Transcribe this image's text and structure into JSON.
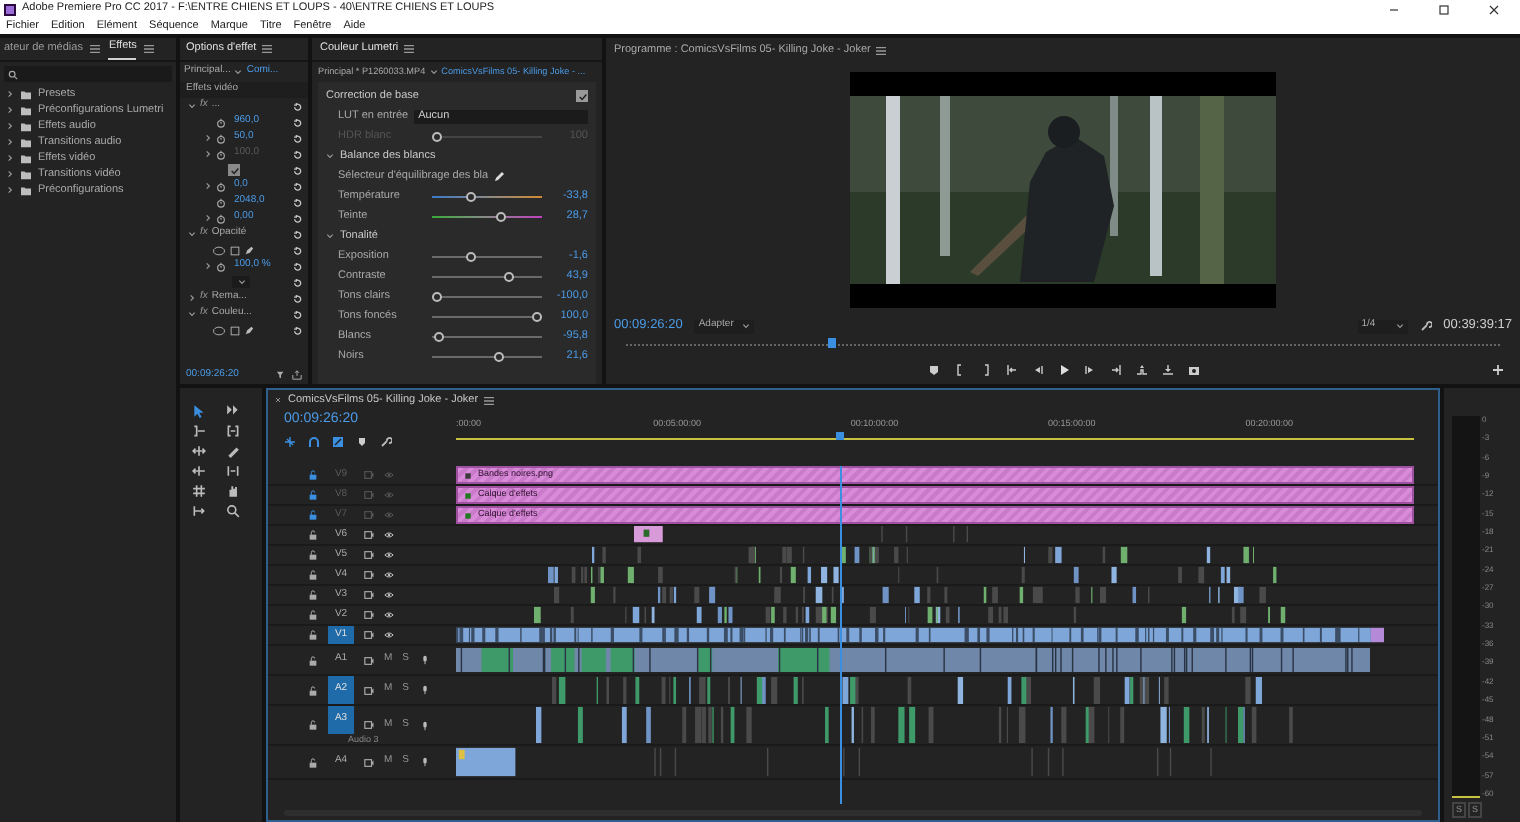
{
  "window": {
    "title": "Adobe Premiere Pro CC 2017 - F:\\ENTRE CHIENS ET LOUPS - 40\\ENTRE CHIENS ET LOUPS"
  },
  "menu": [
    "Fichier",
    "Edition",
    "Elément",
    "Séquence",
    "Marque",
    "Titre",
    "Fenêtre",
    "Aide"
  ],
  "effects_panel": {
    "tabs": [
      {
        "label": "ateur de médias",
        "selected": false
      },
      {
        "label": "Effets",
        "selected": true
      }
    ],
    "items": [
      {
        "label": "Presets"
      },
      {
        "label": "Préconfigurations Lumetri"
      },
      {
        "label": "Effets audio"
      },
      {
        "label": "Transitions audio"
      },
      {
        "label": "Effets vidéo"
      },
      {
        "label": "Transitions vidéo"
      },
      {
        "label": "Préconfigurations"
      }
    ]
  },
  "effect_options": {
    "tab": "Options d'effet",
    "source": "Principal...",
    "sequence": "Comi...",
    "section": "Effets vidéo",
    "timecode": "00:09:26:20",
    "rows": [
      {
        "kind": "effect",
        "badge": "fx",
        "label": "...",
        "expanded": true
      },
      {
        "kind": "param",
        "value": "960,0",
        "expandable": false,
        "disabled": false
      },
      {
        "kind": "param",
        "value": "50,0",
        "expandable": true,
        "disabled": false
      },
      {
        "kind": "param",
        "value": "100,0",
        "expandable": true,
        "disabled": true
      },
      {
        "kind": "checkbox",
        "checked": true
      },
      {
        "kind": "param",
        "value": "0,0",
        "expandable": true,
        "disabled": false
      },
      {
        "kind": "param",
        "value": "2048,0",
        "expandable": false,
        "disabled": false
      },
      {
        "kind": "param",
        "value": "0,00",
        "expandable": true,
        "disabled": false
      },
      {
        "kind": "effect",
        "badge": "fx",
        "label": "Opacité",
        "expanded": true
      },
      {
        "kind": "masks"
      },
      {
        "kind": "param",
        "value": "100,0 %",
        "expandable": true,
        "disabled": false
      },
      {
        "kind": "dropdown"
      },
      {
        "kind": "effect",
        "badge": "fx",
        "label": "Rema...",
        "expanded": false
      },
      {
        "kind": "effect",
        "badge": "fx",
        "label": "Couleu...",
        "expanded": true
      },
      {
        "kind": "masks"
      }
    ]
  },
  "lumetri": {
    "tab": "Couleur Lumetri",
    "source": "Principal * P1260033.MP4",
    "sequence": "ComicsVsFilms 05- Killing Joke - ...",
    "rows": [
      {
        "kind": "section",
        "label": "Correction de base",
        "checked": true
      },
      {
        "kind": "dropdown",
        "label": "LUT en entrée",
        "value": "Aucun"
      },
      {
        "kind": "slider",
        "label": "HDR blanc",
        "level": 0,
        "reading": "100",
        "disabled": true
      },
      {
        "kind": "group",
        "label": "Balance des blancs",
        "expanded": true
      },
      {
        "kind": "picker",
        "label": "Sélecteur d'équilibrage des bla"
      },
      {
        "kind": "temperature-slider",
        "label": "Température",
        "level": 0.33,
        "reading": "-33,8",
        "disabled": false
      },
      {
        "kind": "tint-slider",
        "label": "Teinte",
        "level": 0.64,
        "reading": "28,7",
        "disabled": false
      },
      {
        "kind": "group",
        "label": "Tonalité",
        "expanded": true
      },
      {
        "kind": "slider",
        "label": "Exposition",
        "level": 0.34,
        "reading": "-1,6",
        "disabled": false
      },
      {
        "kind": "slider",
        "label": "Contraste",
        "level": 0.72,
        "reading": "43,9",
        "disabled": false
      },
      {
        "kind": "slider",
        "label": "Tons clairs",
        "level": 0,
        "reading": "-100,0",
        "disabled": false
      },
      {
        "kind": "slider",
        "label": "Tons foncés",
        "level": 1,
        "reading": "100,0",
        "disabled": false
      },
      {
        "kind": "slider",
        "label": "Blancs",
        "level": 0.02,
        "reading": "-95,8",
        "disabled": false
      },
      {
        "kind": "slider",
        "label": "Noirs",
        "level": 0.61,
        "reading": "21,6",
        "disabled": false
      }
    ]
  },
  "program": {
    "title": "Programme : ComicsVsFilms 05- Killing Joke - Joker",
    "timecode": "00:09:26:20",
    "fit": "Adapter",
    "resolution": "1/4",
    "duration": "00:39:39:17",
    "playhead": {
      "level": 0.23
    }
  },
  "timeline": {
    "title": "ComicsVsFilms 05- Killing Joke - Joker",
    "timecode": "00:09:26:20",
    "ruler": [
      ":00:00",
      "00:05:00:00",
      "00:10:00:00",
      "00:15:00:00",
      "00:20:00:00"
    ],
    "playhead": {
      "level": 0.4
    },
    "tools": [
      {
        "selected": true
      },
      {
        "selected": false
      },
      {
        "selected": false
      },
      {
        "selected": false
      },
      {
        "selected": false
      },
      {
        "selected": false
      },
      {
        "selected": false
      },
      {
        "selected": false
      },
      {
        "selected": false
      },
      {
        "selected": false
      },
      {
        "selected": false
      },
      {
        "selected": false
      }
    ],
    "tracks": [
      {
        "kind": "video",
        "name": "V9",
        "locked": true,
        "targeted": false,
        "clip": "Bandes noires.png"
      },
      {
        "kind": "video",
        "name": "V8",
        "locked": true,
        "targeted": false,
        "clip": "Calque d'effets"
      },
      {
        "kind": "video",
        "name": "V7",
        "locked": true,
        "targeted": false,
        "clip": "Calque d'effets"
      },
      {
        "kind": "video",
        "name": "V6",
        "locked": false,
        "targeted": false
      },
      {
        "kind": "video",
        "name": "V5",
        "locked": false,
        "targeted": false
      },
      {
        "kind": "video",
        "name": "V4",
        "locked": false,
        "targeted": false
      },
      {
        "kind": "video",
        "name": "V3",
        "locked": false,
        "targeted": false
      },
      {
        "kind": "video",
        "name": "V2",
        "locked": false,
        "targeted": false
      },
      {
        "kind": "video",
        "name": "V1",
        "locked": false,
        "targeted": true
      },
      {
        "kind": "audio",
        "name": "A1",
        "locked": false,
        "targeted": false,
        "buttons": [
          "M",
          "S"
        ]
      },
      {
        "kind": "audio",
        "name": "A2",
        "locked": false,
        "targeted": true,
        "buttons": [
          "M",
          "S"
        ]
      },
      {
        "kind": "audio",
        "name": "A3",
        "locked": false,
        "targeted": true,
        "buttons": [
          "M",
          "S"
        ],
        "sublabel": "Audio 3"
      },
      {
        "kind": "audio",
        "name": "A4",
        "locked": false,
        "targeted": false,
        "buttons": [
          "M",
          "S"
        ]
      }
    ]
  },
  "meter": {
    "scale": [
      "0",
      "-3",
      "-6",
      "-9",
      "-12",
      "-15",
      "-18",
      "-21",
      "-24",
      "-27",
      "-30",
      "-33",
      "-36",
      "-39",
      "-42",
      "-45",
      "-48",
      "-51",
      "-54",
      "-57",
      "-60"
    ],
    "buttons": [
      "S",
      "S"
    ]
  }
}
